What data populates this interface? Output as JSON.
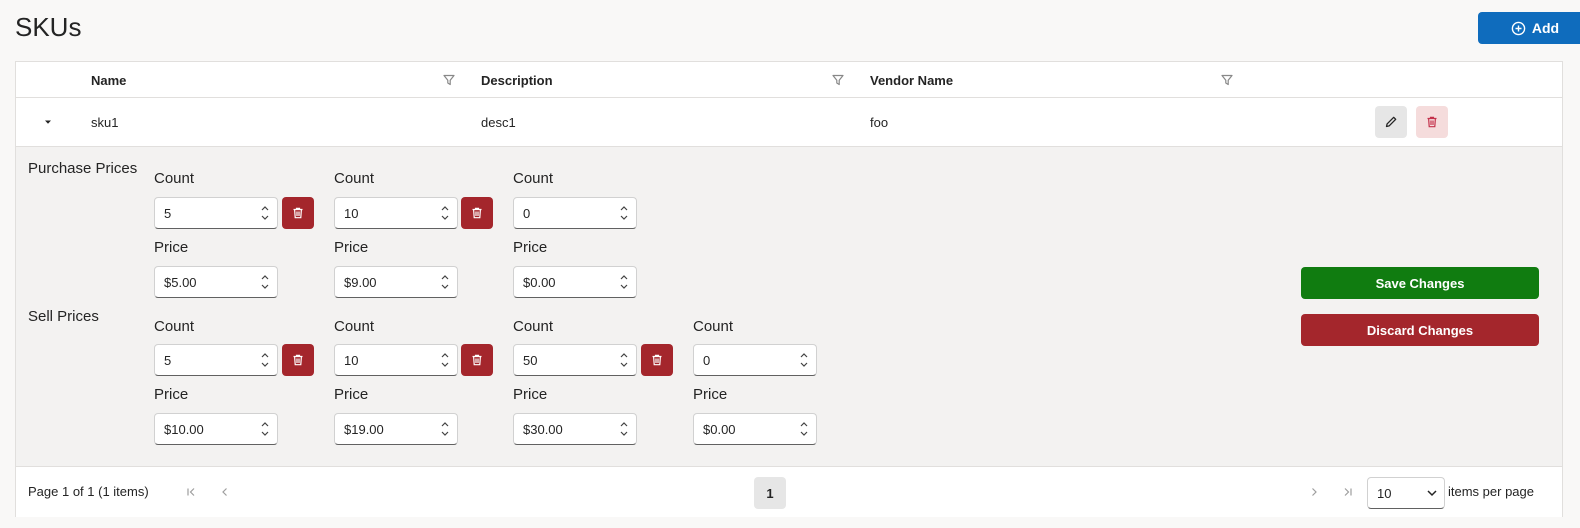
{
  "page": {
    "title": "SKUs",
    "add_label": "Add"
  },
  "grid": {
    "columns": [
      {
        "label": "Name"
      },
      {
        "label": "Description"
      },
      {
        "label": "Vendor Name"
      }
    ],
    "row": {
      "name": "sku1",
      "description": "desc1",
      "vendor": "foo"
    }
  },
  "detail": {
    "purchase_label": "Purchase Prices",
    "sell_label": "Sell Prices",
    "count_label": "Count",
    "price_label": "Price",
    "purchase": [
      {
        "count": "5",
        "price": "$5.00"
      },
      {
        "count": "10",
        "price": "$9.00"
      },
      {
        "count": "0",
        "price": "$0.00"
      }
    ],
    "sell": [
      {
        "count": "5",
        "price": "$10.00"
      },
      {
        "count": "10",
        "price": "$19.00"
      },
      {
        "count": "50",
        "price": "$30.00"
      },
      {
        "count": "0",
        "price": "$0.00"
      }
    ],
    "save_label": "Save Changes",
    "discard_label": "Discard Changes"
  },
  "pager": {
    "info": "Page 1 of 1 (1 items)",
    "current_page": "1",
    "page_size": "10",
    "page_size_label": "items per page"
  },
  "colors": {
    "primary": "#0f6cbd",
    "success": "#107c10",
    "danger": "#a4262c",
    "detail_bg": "#f3f2f1"
  },
  "icons": {
    "add": "plus-circle-icon",
    "filter": "filter-icon",
    "expand": "caret-down-icon",
    "edit": "pencil-icon",
    "delete": "trash-icon",
    "spin": "chevron-up-down-icon",
    "first": "first-page-icon",
    "prev": "chevron-left-icon",
    "next": "chevron-right-icon",
    "last": "last-page-icon",
    "dropdown": "chevron-down-icon"
  }
}
